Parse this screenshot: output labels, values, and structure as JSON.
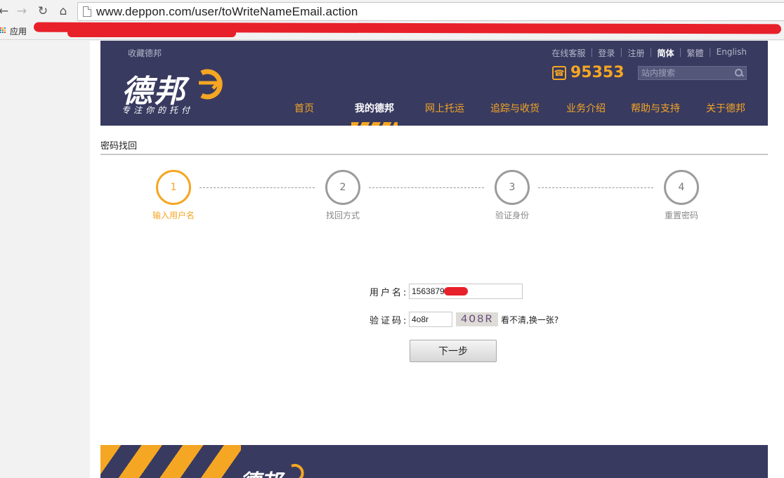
{
  "browser": {
    "url": "www.deppon.com/user/toWriteNameEmail.action",
    "bookmarks_apps": "应用"
  },
  "header": {
    "favorite": "收藏德邦",
    "top_links": [
      "在线客服",
      "登录",
      "注册",
      "简体",
      "繁體",
      "English"
    ],
    "logo_wordmark": "德邦",
    "logo_tagline": "专注你的托付",
    "phone": "95353",
    "search_placeholder": "站内搜索",
    "nav": [
      "首页",
      "我的德邦",
      "网上托运",
      "追踪与收货",
      "业务介绍",
      "帮助与支持",
      "关于德邦"
    ],
    "current_nav": "我的德邦"
  },
  "page": {
    "section_title": "密码找回",
    "steps": [
      {
        "number": "1",
        "label": "输入用户名",
        "active": true
      },
      {
        "number": "2",
        "label": "找回方式",
        "active": false
      },
      {
        "number": "3",
        "label": "验证身份",
        "active": false
      },
      {
        "number": "4",
        "label": "重置密码",
        "active": false
      }
    ],
    "form": {
      "username_label": "用户名:",
      "username_value": "1563879",
      "captcha_label": "验证码:",
      "captcha_value": "4o8r",
      "captcha_image_text": "4O8R",
      "refresh_text": "看不清,换一张?",
      "next_button": "下一步"
    }
  },
  "footer": {
    "logo_wordmark": "德邦"
  },
  "colors": {
    "brand_navy": "#383a60",
    "brand_orange": "#f5a623",
    "redaction": "#e8202a"
  }
}
